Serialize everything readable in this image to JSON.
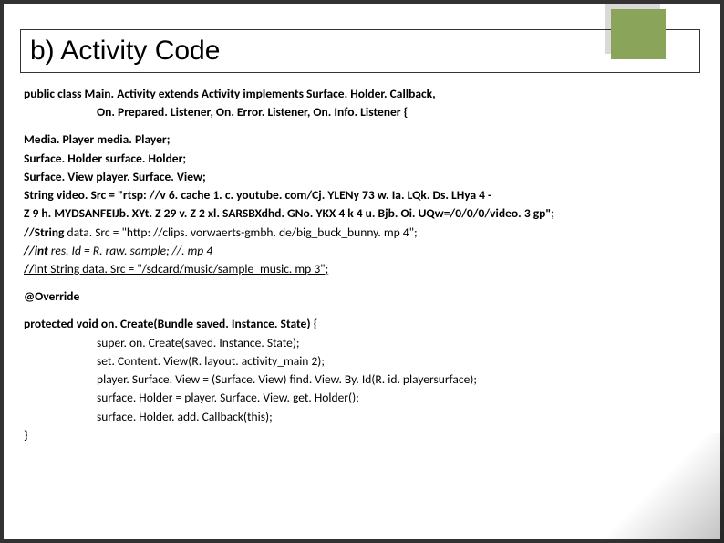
{
  "title": "b) Activity Code",
  "lines": {
    "l1": "public class Main. Activity extends Activity implements Surface. Holder. Callback,",
    "l2": "On. Prepared. Listener, On. Error. Listener, On. Info. Listener {",
    "l3": "Media. Player media. Player;",
    "l4": "Surface. Holder surface. Holder;",
    "l5": "Surface. View player. Surface. View;",
    "l6": "String video. Src = \"rtsp: //v 6. cache 1. c. youtube. com/Cj. YLENy 73 w. Ia. LQk. Ds. LHya 4 -",
    "l7": "Z 9 h. MYDSANFEIJb. XYt. Z 29 v. Z 2 xl. SARSBXdhd. GNo. YKX 4 k 4 u. Bjb. Oi. UQw=/0/0/0/video. 3 gp\";",
    "l8a": "//String",
    "l8b": " data. Src = \"http: //clips. vorwaerts-gmbh. de/big_buck_bunny. mp 4\";",
    "l9a": "//int",
    "l9b": " res. Id = R. raw. ",
    "l9c": "sample; //. mp 4",
    "l10a": "//",
    "l10b": "int",
    "l10c": " String data. Src = \"/sdcard/music/sample_music. mp 3\"; ",
    "l11": "@Override",
    "l12": "protected void on. Create(Bundle saved. Instance. State) {",
    "l13": "super. on. Create(saved. Instance. State);",
    "l14": "set. Content. View(R. layout. activity_main 2);",
    "l15": "player. Surface. View = (Surface. View) find. View. By. Id(R. id. playersurface);",
    "l16": "surface. Holder = player. Surface. View. get. Holder();",
    "l17": "surface. Holder. add. Callback(this);",
    "l18": "}"
  }
}
